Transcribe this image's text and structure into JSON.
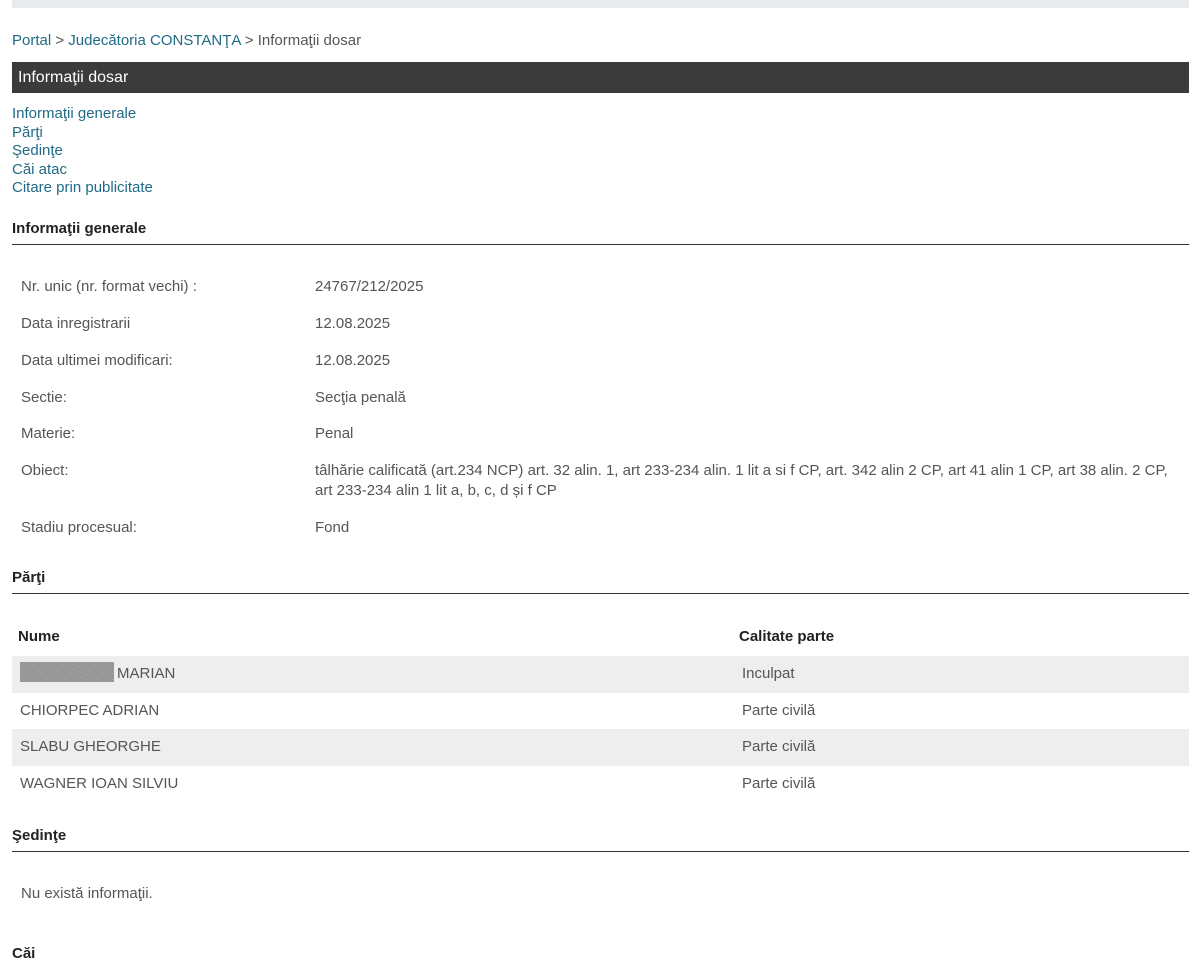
{
  "breadcrumb": {
    "portal": "Portal",
    "sep1": ">",
    "court": "Judecătoria CONSTANŢA",
    "sep2": ">",
    "current": "Informaţii dosar"
  },
  "title": "Informaţii dosar",
  "nav_links": [
    "Informaţii generale",
    "Părţi",
    "Şedinţe",
    "Căi atac",
    "Citare prin publicitate"
  ],
  "info_section": {
    "heading": "Informaţii generale",
    "rows": [
      {
        "label": "Nr. unic (nr. format vechi) :",
        "value": "24767/212/2025"
      },
      {
        "label": "Data inregistrarii",
        "value": "12.08.2025"
      },
      {
        "label": "Data ultimei modificari:",
        "value": "12.08.2025"
      },
      {
        "label": "Sectie:",
        "value": "Secţia penală"
      },
      {
        "label": "Materie:",
        "value": "Penal"
      },
      {
        "label": "Obiect:",
        "value": "tâlhărie calificată (art.234 NCP) art. 32 alin. 1, art 233-234 alin. 1 lit a si f CP, art. 342 alin 2 CP, art 41 alin 1 CP, art 38 alin. 2 CP, art 233-234 alin 1 lit a, b, c, d și f CP"
      },
      {
        "label": "Stadiu procesual:",
        "value": "Fond"
      }
    ]
  },
  "parti_section": {
    "heading": "Părţi",
    "columns": [
      "Nume",
      "Calitate parte"
    ],
    "rows": [
      {
        "name": "MARIAN",
        "role": "Inculpat",
        "redacted": true
      },
      {
        "name": "CHIORPEC ADRIAN",
        "role": "Parte civilă"
      },
      {
        "name": "SLABU GHEORGHE",
        "role": "Parte civilă"
      },
      {
        "name": "WAGNER IOAN SILVIU",
        "role": "Parte civilă"
      }
    ]
  },
  "sedinte_section": {
    "heading": "Şedinţe",
    "empty_message": "Nu există informaţii."
  },
  "next_section_heading": "Căi"
}
